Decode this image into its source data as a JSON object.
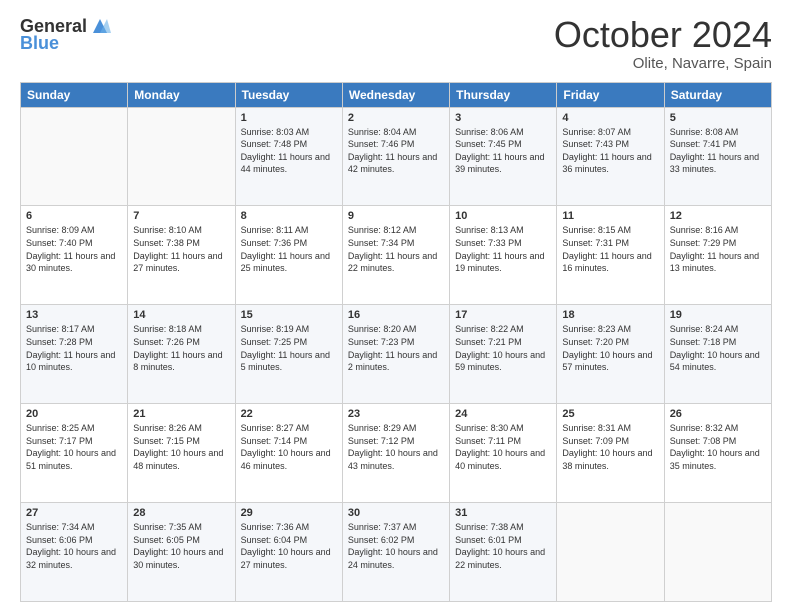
{
  "header": {
    "logo_general": "General",
    "logo_blue": "Blue",
    "month_title": "October 2024",
    "location": "Olite, Navarre, Spain"
  },
  "days_of_week": [
    "Sunday",
    "Monday",
    "Tuesday",
    "Wednesday",
    "Thursday",
    "Friday",
    "Saturday"
  ],
  "weeks": [
    [
      {
        "day": "",
        "info": ""
      },
      {
        "day": "",
        "info": ""
      },
      {
        "day": "1",
        "info": "Sunrise: 8:03 AM\nSunset: 7:48 PM\nDaylight: 11 hours and 44 minutes."
      },
      {
        "day": "2",
        "info": "Sunrise: 8:04 AM\nSunset: 7:46 PM\nDaylight: 11 hours and 42 minutes."
      },
      {
        "day": "3",
        "info": "Sunrise: 8:06 AM\nSunset: 7:45 PM\nDaylight: 11 hours and 39 minutes."
      },
      {
        "day": "4",
        "info": "Sunrise: 8:07 AM\nSunset: 7:43 PM\nDaylight: 11 hours and 36 minutes."
      },
      {
        "day": "5",
        "info": "Sunrise: 8:08 AM\nSunset: 7:41 PM\nDaylight: 11 hours and 33 minutes."
      }
    ],
    [
      {
        "day": "6",
        "info": "Sunrise: 8:09 AM\nSunset: 7:40 PM\nDaylight: 11 hours and 30 minutes."
      },
      {
        "day": "7",
        "info": "Sunrise: 8:10 AM\nSunset: 7:38 PM\nDaylight: 11 hours and 27 minutes."
      },
      {
        "day": "8",
        "info": "Sunrise: 8:11 AM\nSunset: 7:36 PM\nDaylight: 11 hours and 25 minutes."
      },
      {
        "day": "9",
        "info": "Sunrise: 8:12 AM\nSunset: 7:34 PM\nDaylight: 11 hours and 22 minutes."
      },
      {
        "day": "10",
        "info": "Sunrise: 8:13 AM\nSunset: 7:33 PM\nDaylight: 11 hours and 19 minutes."
      },
      {
        "day": "11",
        "info": "Sunrise: 8:15 AM\nSunset: 7:31 PM\nDaylight: 11 hours and 16 minutes."
      },
      {
        "day": "12",
        "info": "Sunrise: 8:16 AM\nSunset: 7:29 PM\nDaylight: 11 hours and 13 minutes."
      }
    ],
    [
      {
        "day": "13",
        "info": "Sunrise: 8:17 AM\nSunset: 7:28 PM\nDaylight: 11 hours and 10 minutes."
      },
      {
        "day": "14",
        "info": "Sunrise: 8:18 AM\nSunset: 7:26 PM\nDaylight: 11 hours and 8 minutes."
      },
      {
        "day": "15",
        "info": "Sunrise: 8:19 AM\nSunset: 7:25 PM\nDaylight: 11 hours and 5 minutes."
      },
      {
        "day": "16",
        "info": "Sunrise: 8:20 AM\nSunset: 7:23 PM\nDaylight: 11 hours and 2 minutes."
      },
      {
        "day": "17",
        "info": "Sunrise: 8:22 AM\nSunset: 7:21 PM\nDaylight: 10 hours and 59 minutes."
      },
      {
        "day": "18",
        "info": "Sunrise: 8:23 AM\nSunset: 7:20 PM\nDaylight: 10 hours and 57 minutes."
      },
      {
        "day": "19",
        "info": "Sunrise: 8:24 AM\nSunset: 7:18 PM\nDaylight: 10 hours and 54 minutes."
      }
    ],
    [
      {
        "day": "20",
        "info": "Sunrise: 8:25 AM\nSunset: 7:17 PM\nDaylight: 10 hours and 51 minutes."
      },
      {
        "day": "21",
        "info": "Sunrise: 8:26 AM\nSunset: 7:15 PM\nDaylight: 10 hours and 48 minutes."
      },
      {
        "day": "22",
        "info": "Sunrise: 8:27 AM\nSunset: 7:14 PM\nDaylight: 10 hours and 46 minutes."
      },
      {
        "day": "23",
        "info": "Sunrise: 8:29 AM\nSunset: 7:12 PM\nDaylight: 10 hours and 43 minutes."
      },
      {
        "day": "24",
        "info": "Sunrise: 8:30 AM\nSunset: 7:11 PM\nDaylight: 10 hours and 40 minutes."
      },
      {
        "day": "25",
        "info": "Sunrise: 8:31 AM\nSunset: 7:09 PM\nDaylight: 10 hours and 38 minutes."
      },
      {
        "day": "26",
        "info": "Sunrise: 8:32 AM\nSunset: 7:08 PM\nDaylight: 10 hours and 35 minutes."
      }
    ],
    [
      {
        "day": "27",
        "info": "Sunrise: 7:34 AM\nSunset: 6:06 PM\nDaylight: 10 hours and 32 minutes."
      },
      {
        "day": "28",
        "info": "Sunrise: 7:35 AM\nSunset: 6:05 PM\nDaylight: 10 hours and 30 minutes."
      },
      {
        "day": "29",
        "info": "Sunrise: 7:36 AM\nSunset: 6:04 PM\nDaylight: 10 hours and 27 minutes."
      },
      {
        "day": "30",
        "info": "Sunrise: 7:37 AM\nSunset: 6:02 PM\nDaylight: 10 hours and 24 minutes."
      },
      {
        "day": "31",
        "info": "Sunrise: 7:38 AM\nSunset: 6:01 PM\nDaylight: 10 hours and 22 minutes."
      },
      {
        "day": "",
        "info": ""
      },
      {
        "day": "",
        "info": ""
      }
    ]
  ]
}
